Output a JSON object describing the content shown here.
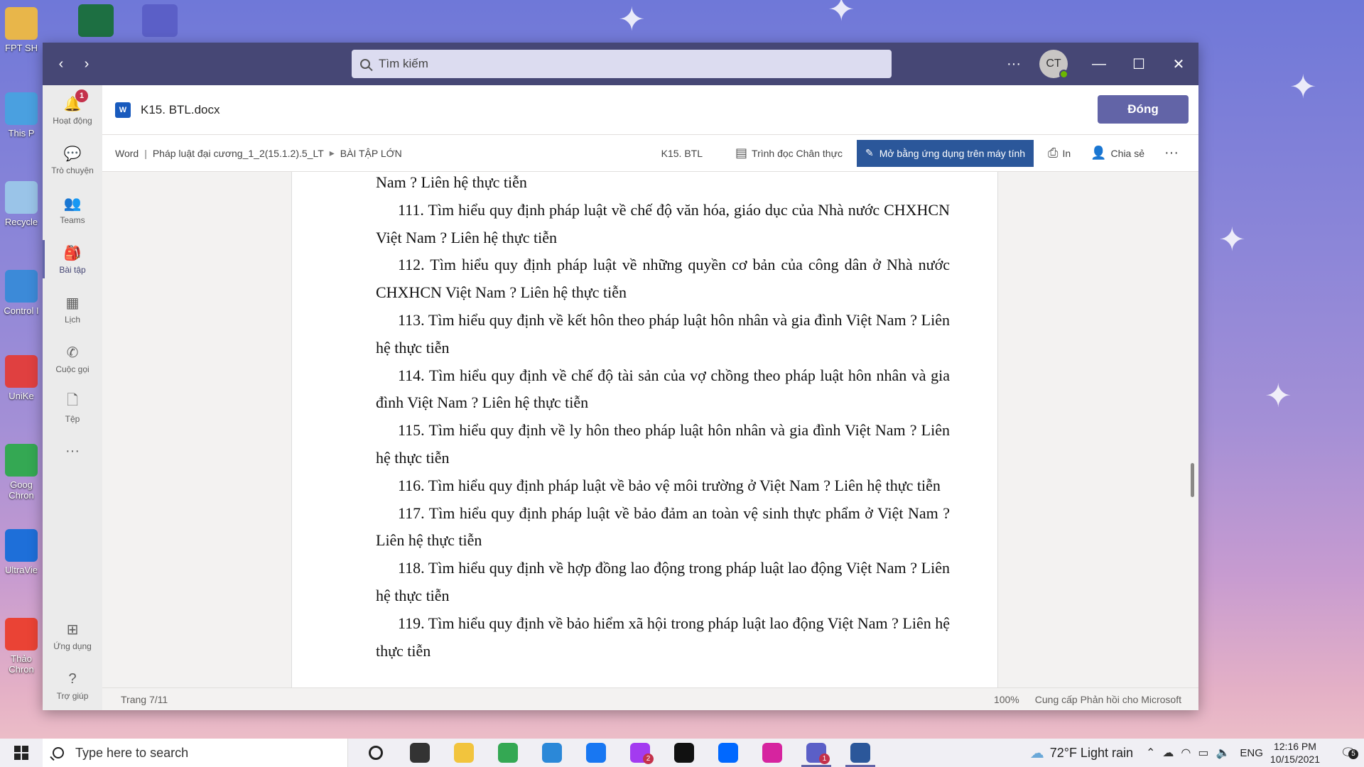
{
  "desktop": {
    "icons": [
      {
        "label": "FPT SH",
        "color": "#e8b64a"
      },
      {
        "label": "This P",
        "color": "#4aa0e0"
      },
      {
        "label": "Recycle",
        "color": "#9ac4e8"
      },
      {
        "label": "Control I",
        "color": "#3c8ad8"
      },
      {
        "label": "UniKe",
        "color": "#e04040"
      },
      {
        "label": "Goog Chron",
        "color": "#34a853"
      },
      {
        "label": "UltraVie",
        "color": "#1e6fd9"
      },
      {
        "label": "Thảo Chron",
        "color": "#ea4335"
      }
    ]
  },
  "window": {
    "search_placeholder": "Tìm kiếm",
    "avatar_initials": "CT",
    "more_label": "···",
    "minimize_label": "—",
    "maximize_label": "☐",
    "close_label": "✕",
    "back_label": "‹",
    "forward_label": "›"
  },
  "rail": {
    "items": [
      {
        "label": "Hoạt động",
        "icon": "bell-icon",
        "glyph": "🔔",
        "badge": "1"
      },
      {
        "label": "Trò chuyện",
        "icon": "chat-icon",
        "glyph": "💬"
      },
      {
        "label": "Teams",
        "icon": "teams-icon",
        "glyph": "👥"
      },
      {
        "label": "Bài tập",
        "icon": "assignments-icon",
        "glyph": "🎒"
      },
      {
        "label": "Lịch",
        "icon": "calendar-icon",
        "glyph": "▦"
      },
      {
        "label": "Cuộc gọi",
        "icon": "phone-icon",
        "glyph": "✆"
      },
      {
        "label": "Tệp",
        "icon": "file-icon",
        "glyph": "🗋"
      }
    ],
    "more": "···",
    "bottom": [
      {
        "label": "Ứng dụng",
        "icon": "apps-icon",
        "glyph": "⊞"
      },
      {
        "label": "Trợ giúp",
        "icon": "help-icon",
        "glyph": "?"
      }
    ]
  },
  "file": {
    "name": "K15. BTL.docx",
    "word_badge": "W",
    "close_button": "Đóng"
  },
  "cmdbar": {
    "breadcrumb": [
      "Word",
      "Pháp luật đại cương_1_2(15.1.2).5_LT",
      "BÀI TẬP LỚN"
    ],
    "doc_title": "K15. BTL",
    "immersive_reader": "Trình đọc Chân thực",
    "open_desktop": "Mở bằng ứng dụng trên máy tính",
    "print": "In",
    "share": "Chia sẻ",
    "more": "···"
  },
  "document": {
    "paragraphs": [
      {
        "text": "Nam ? Liên hệ thực tiễn",
        "cont": true
      },
      {
        "text": "111. Tìm hiểu quy định pháp luật về chế độ văn hóa, giáo dục của Nhà nước CHXHCN Việt Nam ? Liên hệ thực tiễn",
        "cont": false
      },
      {
        "text": "112. Tìm hiểu quy định pháp luật về những quyền cơ bản của công dân ở Nhà nước CHXHCN Việt Nam ? Liên hệ thực tiễn",
        "cont": false
      },
      {
        "text": "113. Tìm hiểu quy định về kết hôn theo pháp luật hôn nhân và gia đình Việt Nam ? Liên hệ thực tiễn",
        "cont": false
      },
      {
        "text": "114. Tìm hiểu quy định về chế độ tài sản của vợ chồng theo pháp luật hôn nhân và gia đình Việt Nam ? Liên hệ thực tiễn",
        "cont": false
      },
      {
        "text": "115. Tìm hiểu quy định về ly hôn theo pháp luật hôn nhân và gia đình Việt Nam ? Liên hệ thực tiễn",
        "cont": false
      },
      {
        "text": "116. Tìm hiểu quy định pháp luật về bảo vệ môi trường ở Việt Nam ? Liên hệ thực tiễn",
        "cont": false
      },
      {
        "text": "117. Tìm hiểu quy định pháp luật về bảo đảm an toàn vệ sinh thực phẩm ở Việt Nam ? Liên hệ thực tiễn",
        "cont": false
      },
      {
        "text": "118. Tìm hiểu quy định về hợp đồng lao động trong pháp luật lao động Việt Nam ? Liên hệ thực tiễn",
        "cont": false
      },
      {
        "text": "119. Tìm hiểu quy định về bảo hiểm xã hội trong pháp luật lao động Việt Nam ? Liên hệ thực tiễn",
        "cont": false
      }
    ]
  },
  "status": {
    "page": "Trang 7/11",
    "zoom": "100%",
    "feedback": "Cung cấp Phản hồi cho Microsoft"
  },
  "taskbar": {
    "search_placeholder": "Type here to search",
    "apps": [
      {
        "name": "cortana-icon",
        "color": "#222222",
        "open": false
      },
      {
        "name": "task-view-icon",
        "color": "#333333",
        "open": false
      },
      {
        "name": "file-explorer-icon",
        "color": "#f2c43d",
        "open": false
      },
      {
        "name": "chrome-icon",
        "color": "#34a853",
        "open": false
      },
      {
        "name": "app-blue-icon",
        "color": "#2b88d8",
        "open": false
      },
      {
        "name": "facebook-icon",
        "color": "#1877f2",
        "open": false
      },
      {
        "name": "messenger-icon",
        "color": "#a33bf0",
        "open": false,
        "badge": "2"
      },
      {
        "name": "tiktok-icon",
        "color": "#111111",
        "open": false
      },
      {
        "name": "zalo-icon",
        "color": "#0068ff",
        "open": false
      },
      {
        "name": "instagram-icon",
        "color": "#d6249f",
        "open": false
      },
      {
        "name": "teams-icon",
        "color": "#5b5fc7",
        "open": true,
        "badge": "1"
      },
      {
        "name": "word-icon",
        "color": "#2b579a",
        "open": true
      }
    ],
    "weather": "72°F  Light rain",
    "language": "ENG",
    "time": "12:16 PM",
    "date": "10/15/2021",
    "notification_count": "5"
  }
}
